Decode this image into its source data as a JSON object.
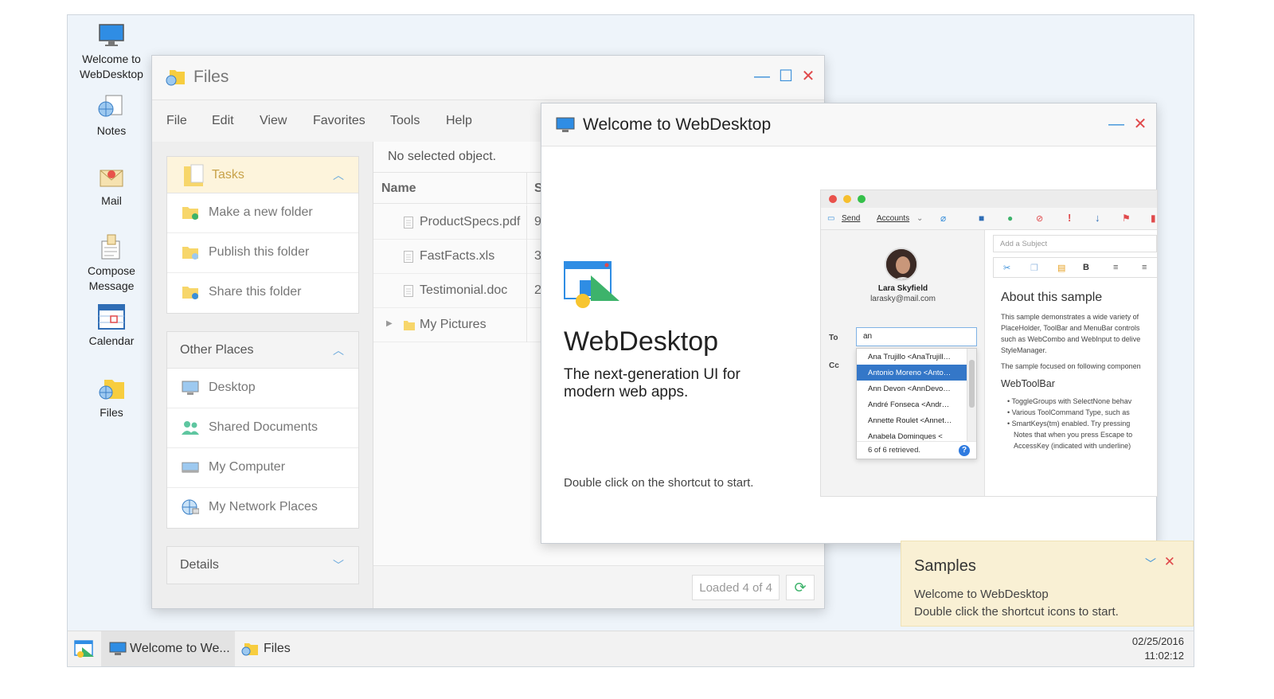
{
  "desktop": {
    "shortcuts": [
      {
        "label": "Welcome to WebDesktop",
        "icon": "monitor-icon"
      },
      {
        "label": "Notes",
        "icon": "notes-icon"
      },
      {
        "label": "Mail",
        "icon": "mail-icon"
      },
      {
        "label": "Compose Message",
        "icon": "compose-icon"
      },
      {
        "label": "Calendar",
        "icon": "calendar-icon"
      },
      {
        "label": "Files",
        "icon": "folder-icon"
      }
    ]
  },
  "files_window": {
    "title": "Files",
    "menu": [
      "File",
      "Edit",
      "View",
      "Favorites",
      "Tools",
      "Help"
    ],
    "tasks_panel": {
      "title": "Tasks",
      "items": [
        "Make a new folder",
        "Publish this folder",
        "Share this folder"
      ]
    },
    "places_panel": {
      "title": "Other Places",
      "items": [
        "Desktop",
        "Shared Documents",
        "My Computer",
        "My Network Places"
      ]
    },
    "details_panel": {
      "title": "Details"
    },
    "breadcrumb": "No selected object.",
    "columns": [
      "Name",
      "S"
    ],
    "rows": [
      {
        "name": "ProductSpecs.pdf",
        "size": "9"
      },
      {
        "name": "FastFacts.xls",
        "size": "3"
      },
      {
        "name": "Testimonial.doc",
        "size": "2"
      },
      {
        "name": "My Pictures",
        "size": ""
      }
    ],
    "status": "Loaded 4 of 4"
  },
  "welcome_window": {
    "title": "Welcome to WebDesktop",
    "heading": "WebDesktop",
    "subtitle": "The next-generation UI for modern web apps.",
    "hint": "Double click on the shortcut to start.",
    "mail": {
      "toolbar": [
        "Send",
        "Accounts"
      ],
      "user_name": "Lara Skyfield",
      "user_email": "larasky@mail.com",
      "to_label": "To",
      "cc_label": "Cc",
      "to_value": "an",
      "suggestions": [
        "Ana Trujillo <AnaTrujill…",
        "Antonio Moreno <Anto…",
        "Ann Devon <AnnDevo…",
        "André Fonseca <Andr…",
        "Annette Roulet <Annet…",
        "Anabela Dominques <"
      ],
      "retrieved": "6 of 6 retrieved.",
      "subject_placeholder": "Add a Subject",
      "about_title": "About this sample",
      "about_lines": [
        "This sample demonstrates a wide variety of",
        "PlaceHolder, ToolBar and MenuBar controls",
        "such as WebCombo and WebInput to delive",
        "StyleManager."
      ],
      "focus_line": "The sample focused on following componen",
      "toolbar_heading": "WebToolBar",
      "bullets": [
        "ToggleGroups with SelectNone behav",
        "Various ToolCommand Type, such as",
        "SmartKeys(tm) enabled. Try pressing",
        "Notes that when you press Escape to",
        "AccessKey (indicated with underline)"
      ]
    }
  },
  "samples": {
    "title": "Samples",
    "line1": "Welcome to WebDesktop",
    "line2": "Double click the shortcut icons to start."
  },
  "taskbar": {
    "tasks": [
      "Welcome to We...",
      "Files"
    ],
    "date": "02/25/2016",
    "time": "11:02:12"
  },
  "colors": {
    "accent": "#3a8fd9",
    "close": "#e0494b",
    "selection": "#3477c8",
    "notification": "#f9f0d4"
  }
}
